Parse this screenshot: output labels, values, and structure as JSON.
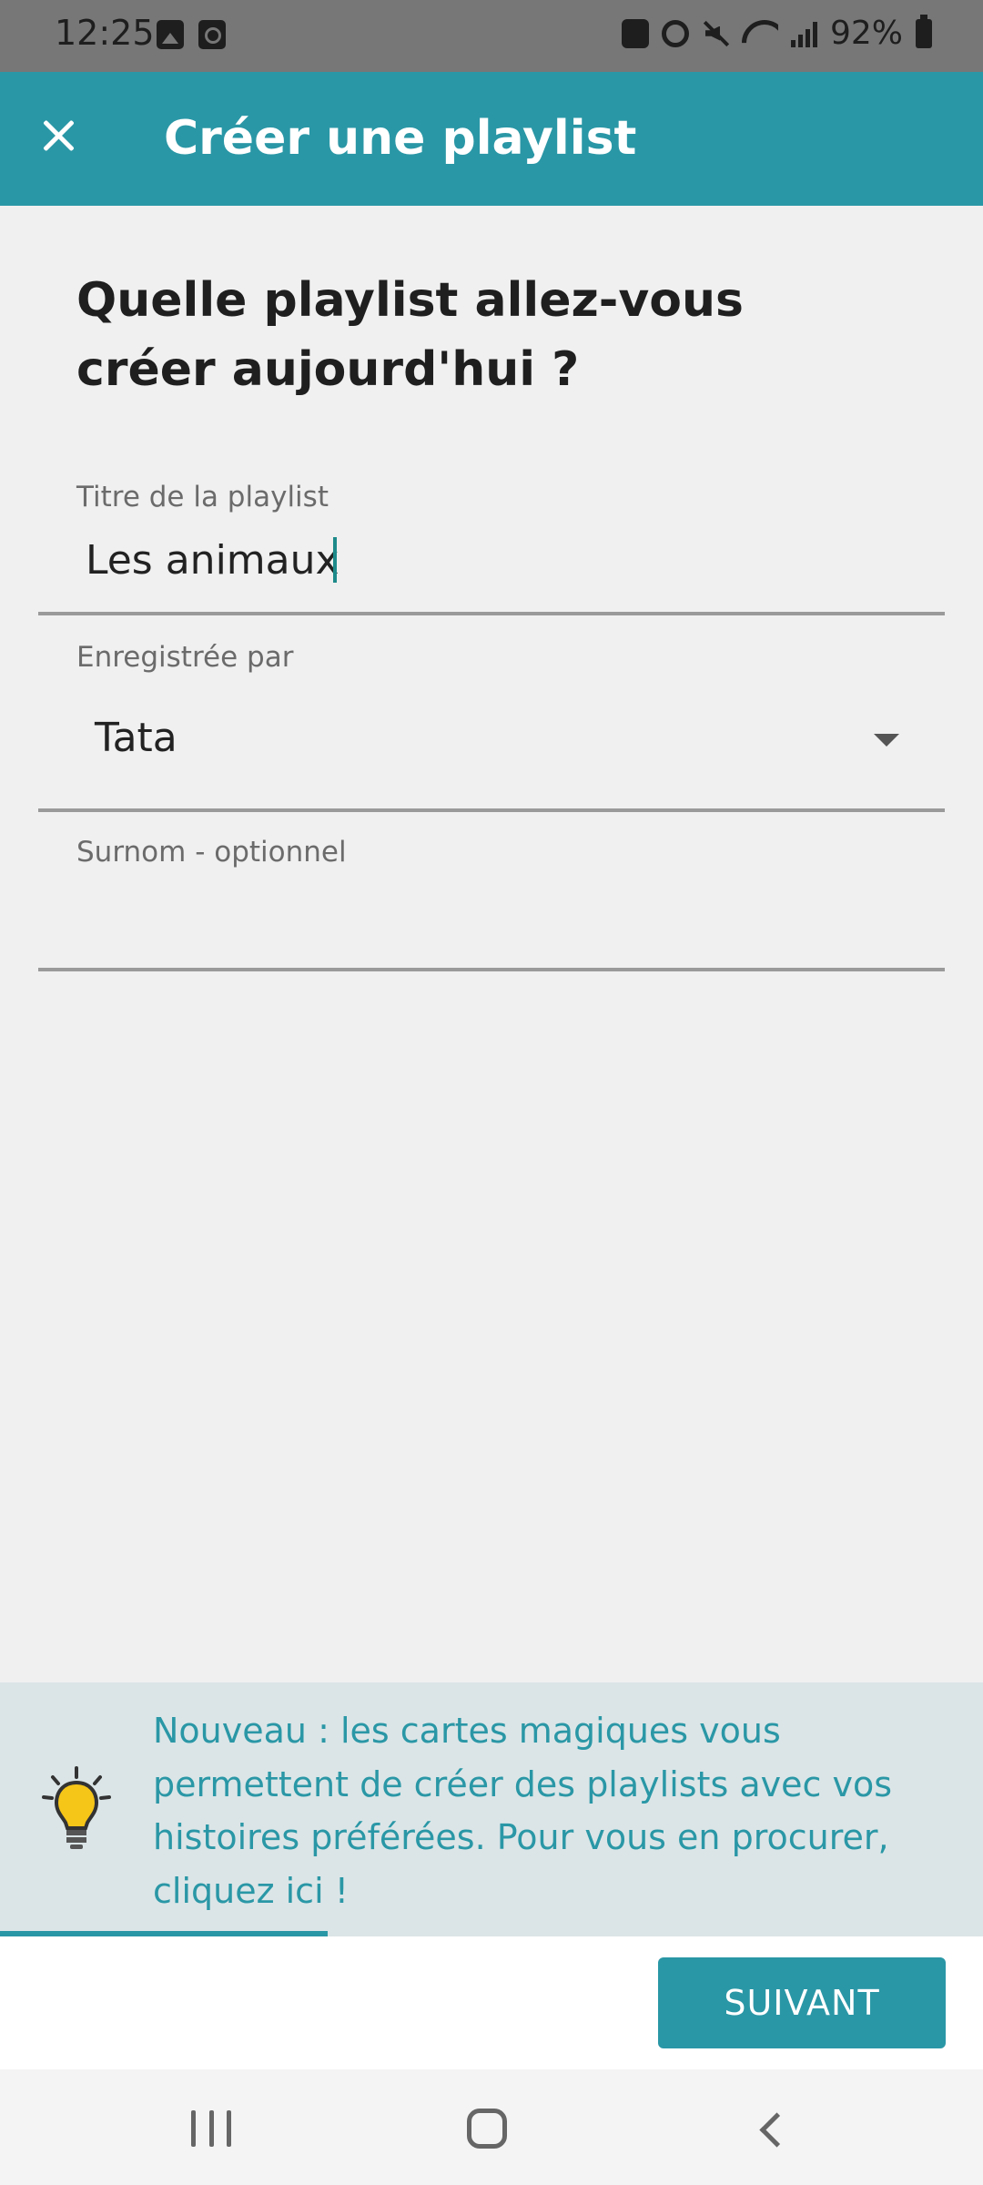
{
  "status_bar": {
    "time": "12:25",
    "battery": "92%",
    "left_icons": [
      "image-icon",
      "clock-app-icon"
    ],
    "right_icons": [
      "lock-icon",
      "alarm-icon",
      "mute-icon",
      "wifi-icon",
      "signal-icon",
      "battery-icon"
    ]
  },
  "app_bar": {
    "title": "Créer une playlist",
    "close_icon": "close-icon",
    "color": "#2a97a6"
  },
  "form": {
    "question": "Quelle playlist allez-vous créer aujourd'hui ?",
    "title_field": {
      "label": "Titre de la playlist",
      "value": "Les animaux"
    },
    "recorded_by": {
      "label": "Enregistrée par",
      "value": "Tata"
    },
    "nickname": {
      "label": "Surnom - optionnel",
      "value": ""
    }
  },
  "banner": {
    "icon": "lightbulb-icon",
    "text": "Nouveau : les cartes magiques vous permettent de créer des playlists avec vos histoires préférées. Pour vous en procurer, cliquez ici !"
  },
  "actions": {
    "next_label": "SUIVANT"
  },
  "nav_bar": {
    "icons": [
      "recents-icon",
      "home-icon",
      "back-icon"
    ]
  }
}
